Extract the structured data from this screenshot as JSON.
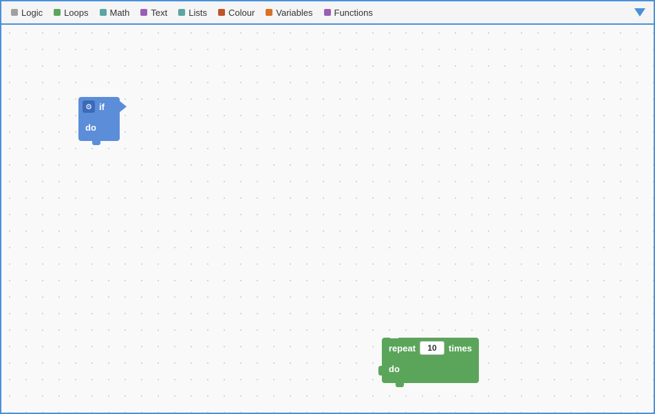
{
  "toolbar": {
    "items": [
      {
        "id": "logic",
        "label": "Logic",
        "dotClass": "dot-logic"
      },
      {
        "id": "loops",
        "label": "Loops",
        "dotClass": "dot-loops"
      },
      {
        "id": "math",
        "label": "Math",
        "dotClass": "dot-math"
      },
      {
        "id": "text",
        "label": "Text",
        "dotClass": "dot-text"
      },
      {
        "id": "lists",
        "label": "Lists",
        "dotClass": "dot-lists"
      },
      {
        "id": "colour",
        "label": "Colour",
        "dotClass": "dot-colour"
      },
      {
        "id": "variables",
        "label": "Variables",
        "dotClass": "dot-variables"
      },
      {
        "id": "functions",
        "label": "Functions",
        "dotClass": "dot-functions"
      }
    ]
  },
  "blocks": {
    "if_block": {
      "top_label": "if",
      "bottom_label": "do"
    },
    "repeat_block": {
      "label_before": "repeat",
      "input_value": "10",
      "label_after": "times",
      "bottom_label": "do"
    }
  }
}
